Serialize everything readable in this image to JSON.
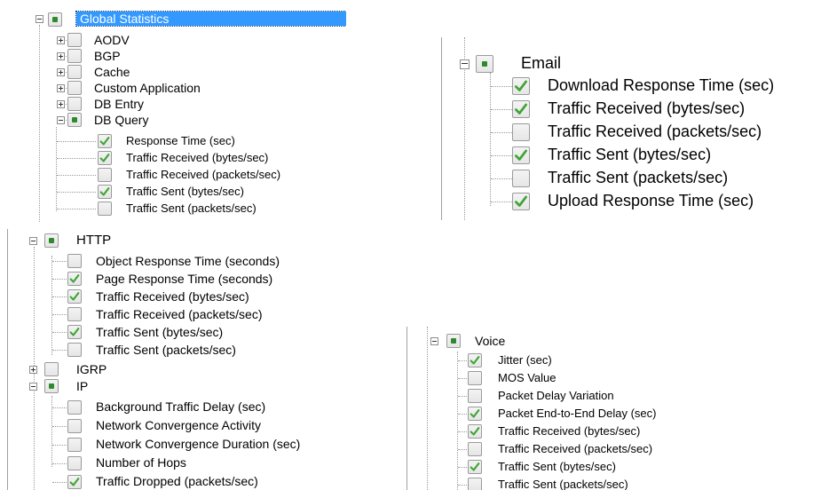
{
  "panel1": {
    "root": "Global Statistics",
    "items": [
      "AODV",
      "BGP",
      "Cache",
      "Custom Application",
      "DB Entry",
      "DB Query"
    ],
    "children": [
      "Response Time (sec)",
      "Traffic Received (bytes/sec)",
      "Traffic Received (packets/sec)",
      "Traffic Sent (bytes/sec)",
      "Traffic Sent (packets/sec)"
    ],
    "checked": [
      true,
      true,
      false,
      true,
      false
    ]
  },
  "panel2": {
    "group": "Email",
    "children": [
      "Download Response Time (sec)",
      "Traffic Received (bytes/sec)",
      "Traffic Received (packets/sec)",
      "Traffic Sent (bytes/sec)",
      "Traffic Sent (packets/sec)",
      "Upload Response Time (sec)"
    ],
    "checked": [
      true,
      true,
      false,
      true,
      false,
      true
    ]
  },
  "panel3": {
    "group": "HTTP",
    "children": [
      "Object Response Time (seconds)",
      "Page Response Time (seconds)",
      "Traffic Received (bytes/sec)",
      "Traffic Received (packets/sec)",
      "Traffic Sent (bytes/sec)",
      "Traffic Sent (packets/sec)"
    ],
    "checked": [
      false,
      true,
      true,
      false,
      true,
      false
    ],
    "igrp": "IGRP",
    "ip": "IP",
    "ip_children": [
      "Background Traffic Delay (sec)",
      "Network Convergence Activity",
      "Network Convergence Duration (sec)",
      "Number of Hops",
      "Traffic Dropped (packets/sec)"
    ],
    "ip_checked": [
      false,
      false,
      false,
      false,
      true
    ]
  },
  "panel4": {
    "group": "Voice",
    "children": [
      "Jitter (sec)",
      "MOS Value",
      "Packet Delay Variation",
      "Packet End-to-End Delay (sec)",
      "Traffic Received (bytes/sec)",
      "Traffic Received (packets/sec)",
      "Traffic Sent (bytes/sec)",
      "Traffic Sent (packets/sec)"
    ],
    "checked": [
      true,
      false,
      false,
      true,
      true,
      false,
      true,
      false
    ]
  },
  "colors": {
    "check": "#3fa534",
    "partial": "#2f8a2f",
    "selection": "#3399ff"
  }
}
